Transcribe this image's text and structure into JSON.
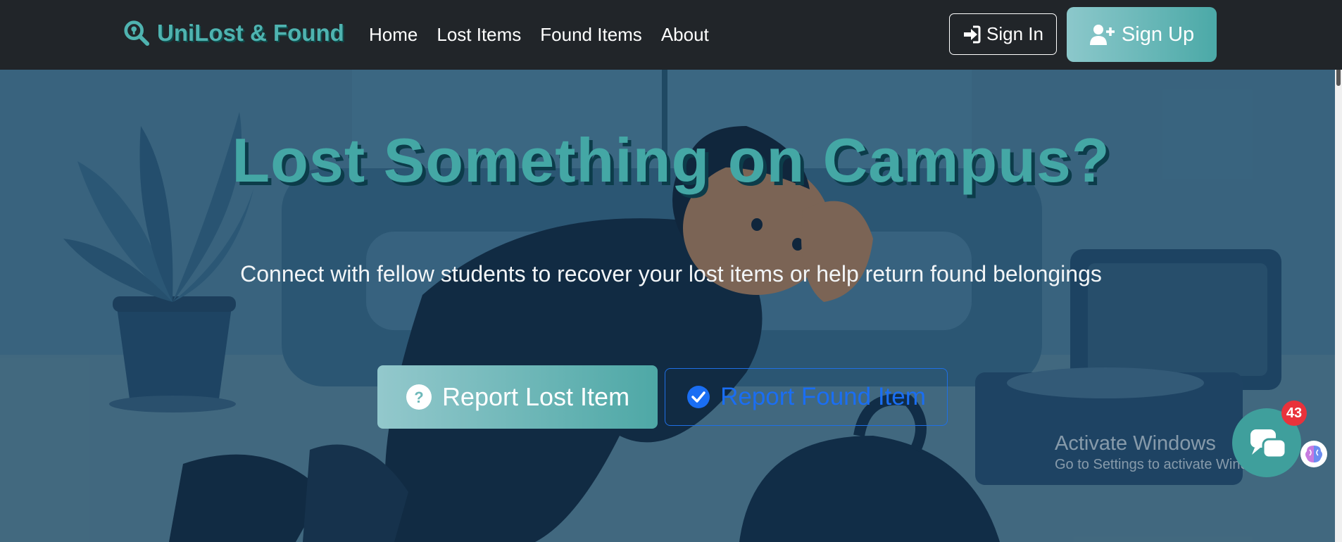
{
  "brand": {
    "name": "UniLost & Found",
    "icon": "search-location-icon",
    "color": "#4fb3b0"
  },
  "nav": {
    "links": [
      {
        "label": "Home"
      },
      {
        "label": "Lost Items"
      },
      {
        "label": "Found Items"
      },
      {
        "label": "About"
      }
    ],
    "sign_in": {
      "label": "Sign In",
      "icon": "sign-in-icon"
    },
    "sign_up": {
      "label": "Sign Up",
      "icon": "user-plus-icon"
    }
  },
  "hero": {
    "title": "Lost Something on Campus?",
    "subtitle": "Connect with fellow students to recover your lost items or help return found belongings",
    "report_lost": {
      "label": "Report Lost Item",
      "icon": "question-circle-icon"
    },
    "report_found": {
      "label": "Report Found Item",
      "icon": "check-circle-icon"
    }
  },
  "windows_watermark": {
    "line1": "Activate Windows",
    "line2": "Go to Settings to activate Windows."
  },
  "chat": {
    "badge_count": "43",
    "icon": "chat-bubble-icon"
  },
  "colors": {
    "navbar": "#212529",
    "accent": "#44a7a5",
    "found_button": "#1a6ef3",
    "badge": "#e9323b"
  }
}
